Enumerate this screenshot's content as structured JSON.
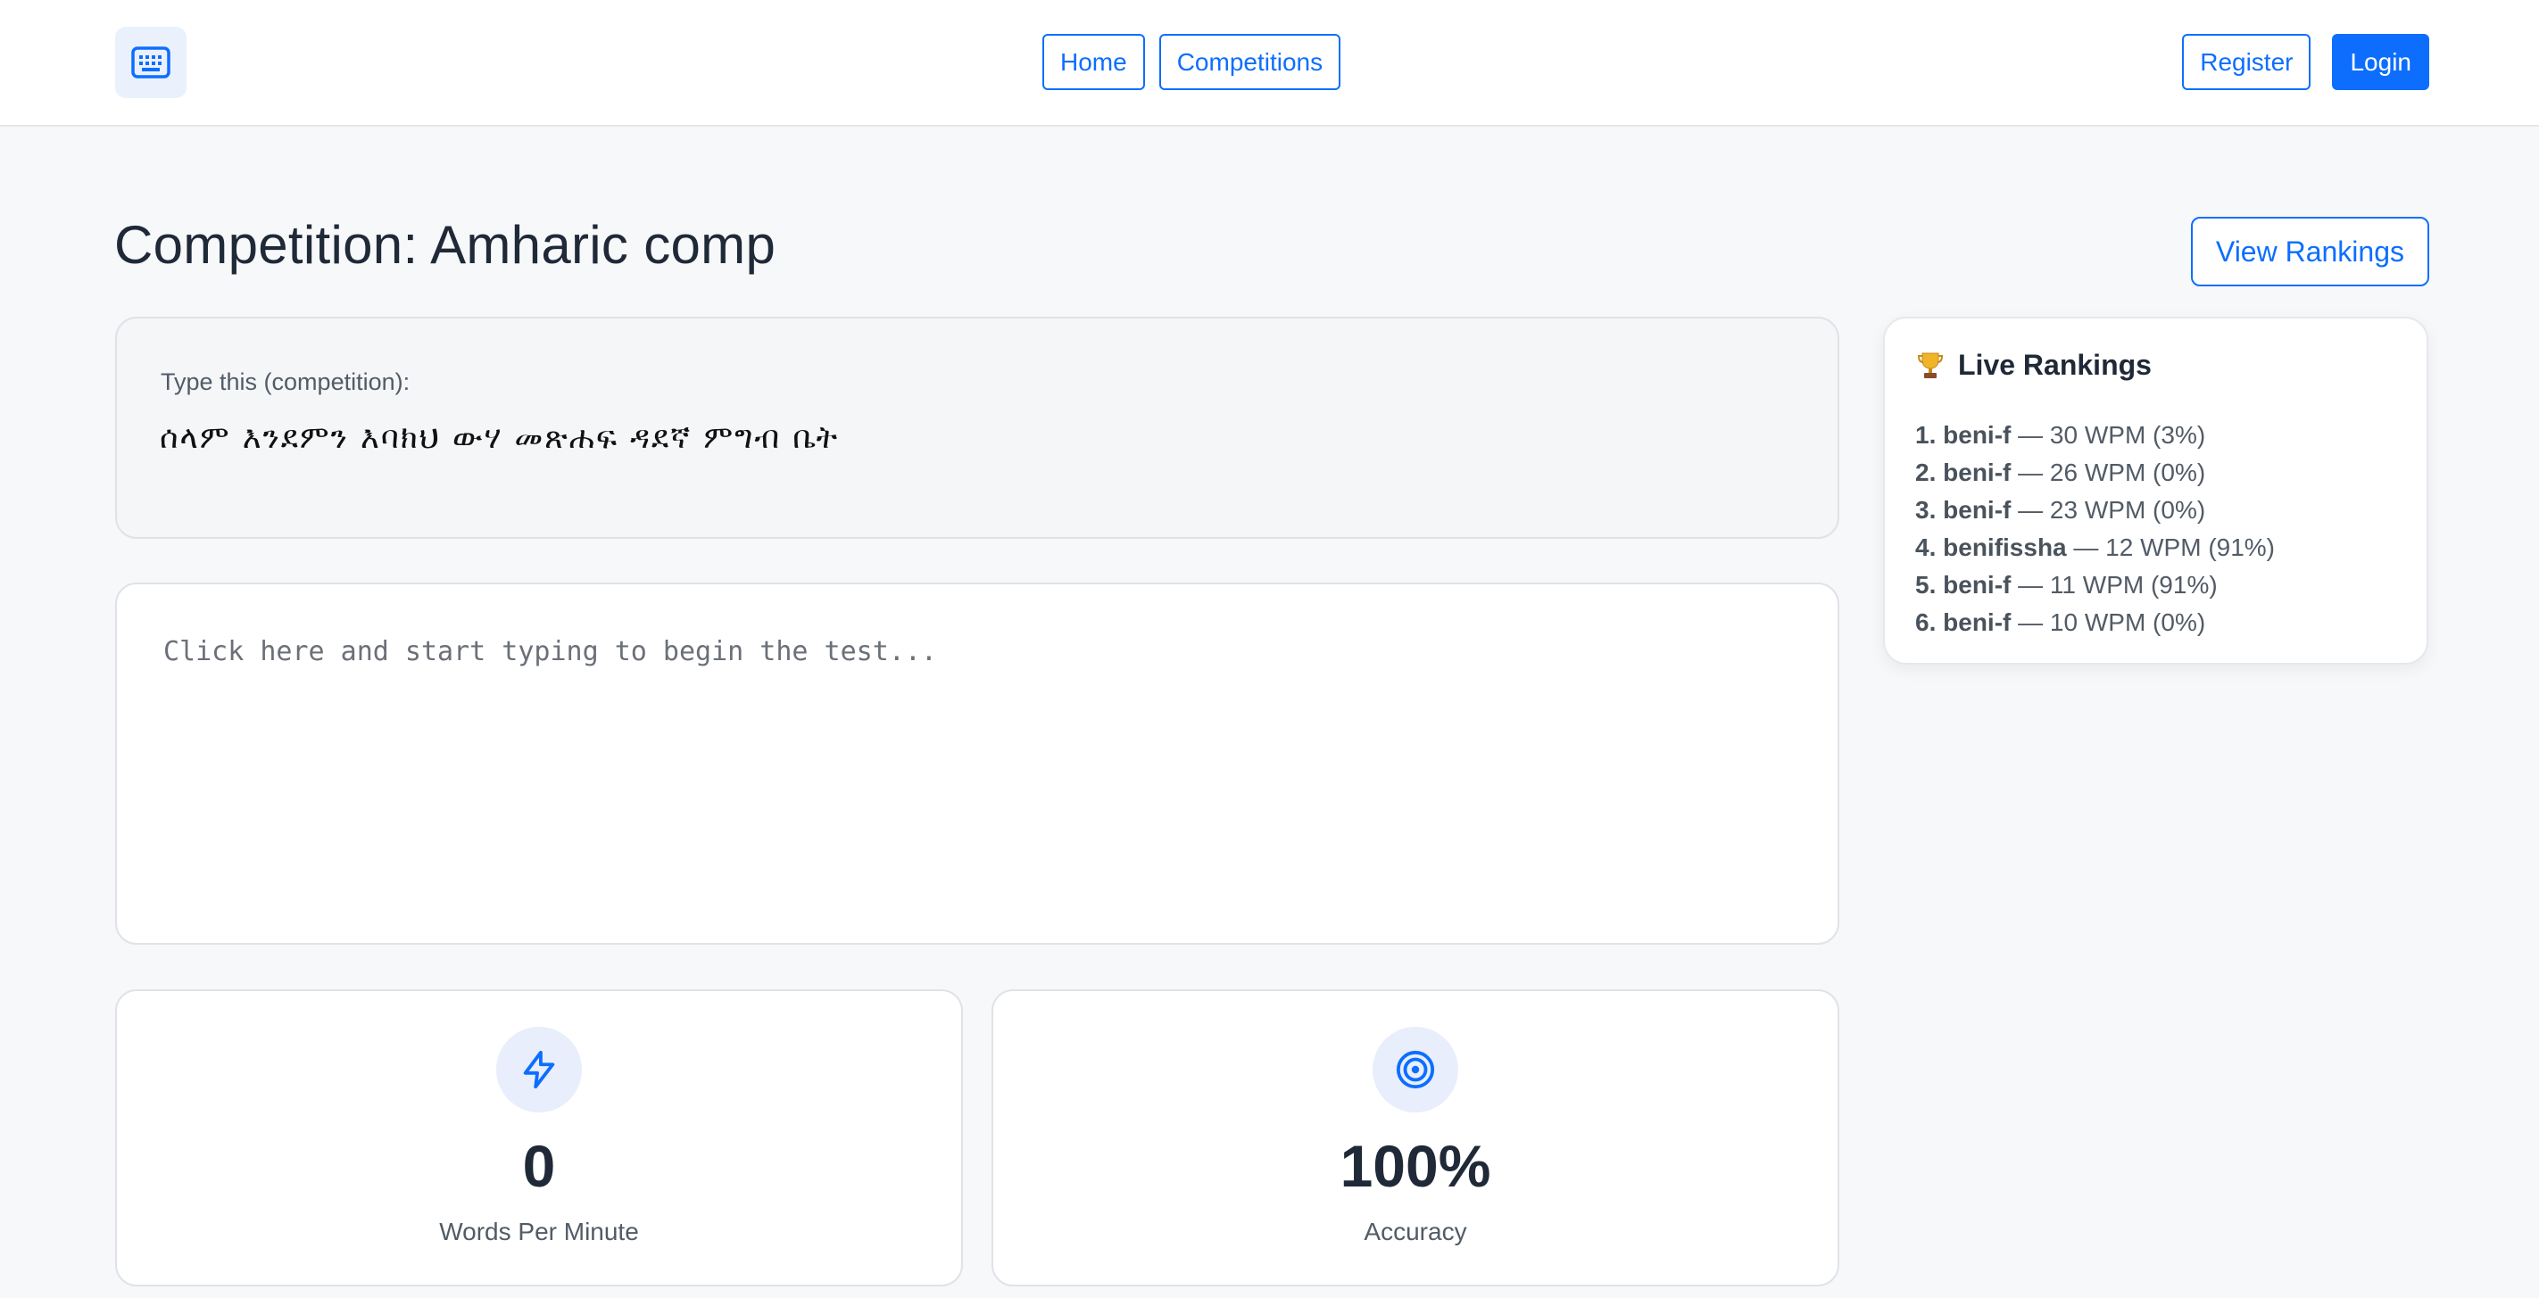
{
  "nav": {
    "logo_icon": "keyboard-icon",
    "home_label": "Home",
    "competitions_label": "Competitions",
    "register_label": "Register",
    "login_label": "Login"
  },
  "page": {
    "title": "Competition: Amharic comp",
    "view_rankings_label": "View Rankings"
  },
  "prompt": {
    "label": "Type this (competition):",
    "text": "ሰላም እንደምን እባክህ ውሃ መጽሐፍ ዳደኛ ምግብ ቤት"
  },
  "typing": {
    "placeholder": "Click here and start typing to begin the test..."
  },
  "stats": {
    "wpm": {
      "icon": "lightning-icon",
      "value": "0",
      "label": "Words Per Minute"
    },
    "accuracy": {
      "icon": "target-icon",
      "value": "100%",
      "label": "Accuracy"
    }
  },
  "rankings": {
    "icon": "trophy-icon",
    "title": "Live Rankings",
    "items": [
      {
        "rank": "1.",
        "name": "beni-f",
        "detail": "— 30 WPM (3%)"
      },
      {
        "rank": "2.",
        "name": "beni-f",
        "detail": "— 26 WPM (0%)"
      },
      {
        "rank": "3.",
        "name": "beni-f",
        "detail": "— 23 WPM (0%)"
      },
      {
        "rank": "4.",
        "name": "benifissha",
        "detail": "— 12 WPM (91%)"
      },
      {
        "rank": "5.",
        "name": "beni-f",
        "detail": "— 11 WPM (91%)"
      },
      {
        "rank": "6.",
        "name": "beni-f",
        "detail": "— 10 WPM (0%)"
      }
    ]
  },
  "colors": {
    "primary": "#0d6efd",
    "background": "#f7f8fa",
    "text": "#1f2937",
    "muted": "#525b66"
  }
}
